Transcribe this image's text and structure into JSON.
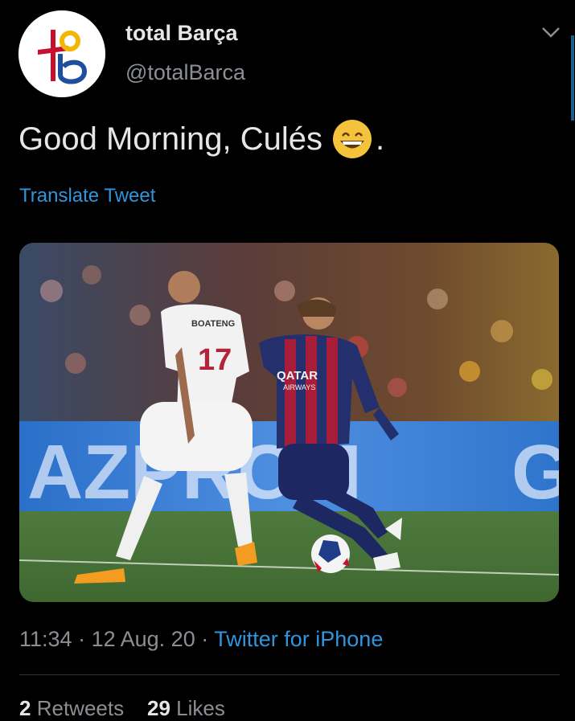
{
  "tweet": {
    "author": {
      "display_name": "total Barça",
      "handle": "@totalBarca"
    },
    "text": "Good Morning, Culés",
    "text_suffix": ".",
    "emoji": "grinning-face-with-smiling-eyes",
    "translate_label": "Translate Tweet",
    "time": "11:34",
    "date": "12 Aug. 20",
    "separator": "·",
    "source": "Twitter for iPhone",
    "stats": {
      "retweets_count": "2",
      "retweets_label": "Retweets",
      "likes_count": "29",
      "likes_label": "Likes"
    },
    "photo": {
      "jersey_number": "17",
      "jersey_name": "BOATENG",
      "sponsor_line1": "QATAR",
      "sponsor_line2": "AIRWAYS",
      "board_text_left": "AZPROM",
      "board_text_right": "G"
    }
  },
  "colors": {
    "link": "#2f95dc",
    "muted": "#8b8f94",
    "background": "#000000"
  }
}
